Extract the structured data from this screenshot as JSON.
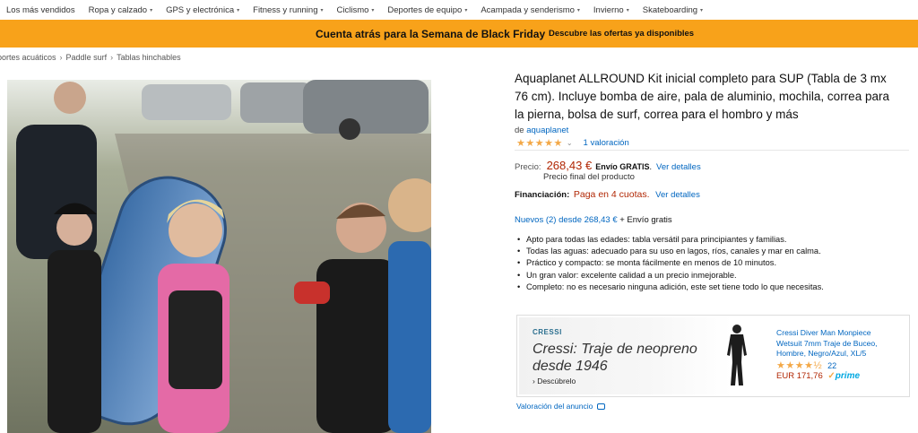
{
  "nav": {
    "categories": [
      {
        "label": "Los más vendidos",
        "has_caret": false
      },
      {
        "label": "Ropa y calzado",
        "has_caret": true
      },
      {
        "label": "GPS y electrónica",
        "has_caret": true
      },
      {
        "label": "Fitness y running",
        "has_caret": true
      },
      {
        "label": "Ciclismo",
        "has_caret": true
      },
      {
        "label": "Deportes de equipo",
        "has_caret": true
      },
      {
        "label": "Acampada y senderismo",
        "has_caret": true
      },
      {
        "label": "Invierno",
        "has_caret": true
      },
      {
        "label": "Skateboarding",
        "has_caret": true
      }
    ],
    "caret_glyph": "▾"
  },
  "promo": {
    "title": "Cuenta atrás para la Semana de Black Friday",
    "link": "Descubre las ofertas ya disponibles",
    "color": "#f8a21a"
  },
  "breadcrumb": {
    "items": [
      "portes acuáticos",
      "Paddle surf",
      "Tablas hinchables"
    ],
    "separator": "›"
  },
  "product": {
    "title": "Aquaplanet ALLROUND Kit inicial completo para SUP (Tabla de 3 mx 76 cm). Incluye bomba de aire, pala de aluminio, mochila, correa para la pierna, bolsa de surf, correa para el hombro y más",
    "by_prefix": "de",
    "brand": "aquaplanet",
    "stars": "★★★★★",
    "rating_chevron": "⌄",
    "rating_count": "1 valoración",
    "price_label": "Precio:",
    "price": "268,43 €",
    "shipping_bold": "Envío GRATIS",
    "shipping_suffix": ".",
    "details_link": "Ver detalles",
    "final_price_note": "Precio final del producto",
    "financing_label": "Financiación:",
    "financing_text": "Paga en 4 cuotas.",
    "financing_link": "Ver detalles",
    "new_offers_link": "Nuevos (2) desde 268,43 €",
    "new_offers_suffix": " + Envío gratis",
    "bullets": [
      "Apto para todas las edades: tabla versátil para principiantes y familias.",
      "Todas las aguas: adecuado para su uso en lagos, ríos, canales y mar en calma.",
      "Práctico y compacto: se monta fácilmente en menos de 10 minutos.",
      "Un gran valor: excelente calidad a un precio inmejorable.",
      "Completo: no es necesario ninguna adición, este set tiene todo lo que necesitas."
    ],
    "accent_price_color": "#b12704",
    "link_color": "#0066c0"
  },
  "ad": {
    "brand": "CRESSI",
    "headline": "Cressi: Traje de neopreno desde 1946",
    "cta": "› Descúbrelo",
    "product_title": "Cressi Diver Man Monpiece Wetsuit 7mm Traje de Buceo, Hombre, Negro/Azul, XL/5",
    "stars": "★★★★½",
    "rating_count": "22",
    "price": "EUR 171,76",
    "prime_check": "✓",
    "prime": "prime",
    "feedback": "Valoración del anuncio"
  },
  "image": {
    "description_icon": "product-photo"
  }
}
